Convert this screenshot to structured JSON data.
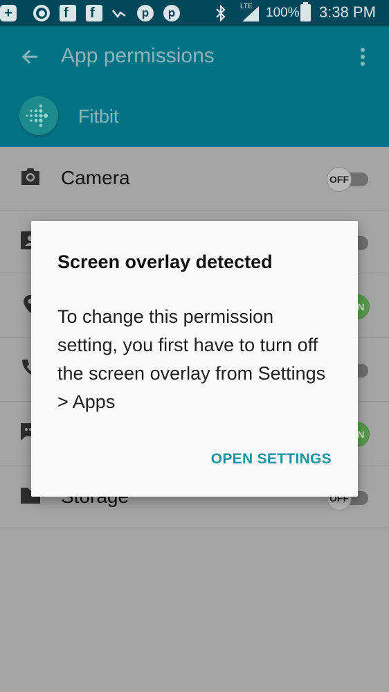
{
  "status_bar": {
    "notification_icons": [
      "add-icon",
      "circle-app-icon",
      "facebook-icon",
      "facebook-icon",
      "check-mark-icon",
      "pinterest-icon",
      "pinterest-icon"
    ],
    "network": "LTE",
    "battery": "100%",
    "time": "3:38 PM"
  },
  "app_bar": {
    "title": "App permissions",
    "app_name": "Fitbit"
  },
  "permissions": [
    {
      "label": "Camera",
      "icon": "camera-icon",
      "state": "OFF"
    },
    {
      "label": "",
      "icon": "contacts-icon",
      "state": "OFF"
    },
    {
      "label": "",
      "icon": "location-icon",
      "state": "ON"
    },
    {
      "label": "",
      "icon": "phone-icon",
      "state": "OFF"
    },
    {
      "label": "",
      "icon": "sms-icon",
      "state": "ON"
    },
    {
      "label": "Storage",
      "icon": "folder-icon",
      "state": "OFF"
    }
  ],
  "dialog": {
    "title": "Screen overlay detected",
    "message": "To change this permission setting, you first have to turn off the screen overlay from Settings > Apps",
    "button": "OPEN SETTINGS"
  },
  "colors": {
    "status_bar": "#02485a",
    "app_bar": "#037384",
    "accent": "#1a94a3",
    "toggle_on": "#5a9a4e"
  }
}
